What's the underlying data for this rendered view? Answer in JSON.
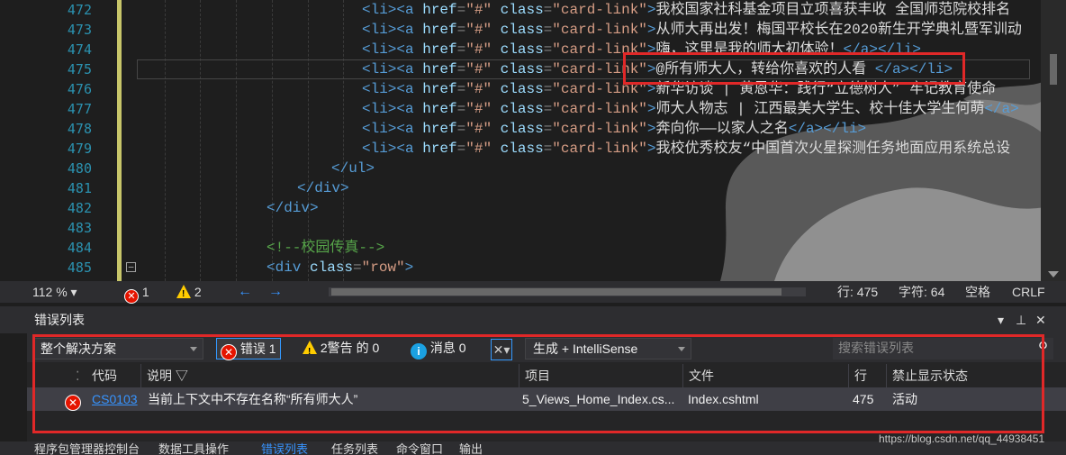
{
  "editor": {
    "lines": [
      {
        "num": "472",
        "text": "我校国家社科基金项目立项喜获丰收 全国师范院校排名"
      },
      {
        "num": "473",
        "text": "从师大再出发！梅国平校长在2020新生开学典礼暨军训动"
      },
      {
        "num": "474",
        "text": "嗨，这里是我的师大初体验！"
      },
      {
        "num": "475",
        "text": "@所有师大人，转给你喜欢的人看"
      },
      {
        "num": "476",
        "text": "新华访谈 | 黄恩华：践行“立德树人” 牢记教育使命"
      },
      {
        "num": "477",
        "text": "师大人物志 | 江西最美大学生、校十佳大学生何萌"
      },
      {
        "num": "478",
        "text": "奔向你——以家人之名"
      },
      {
        "num": "479",
        "text": "我校优秀校友“中国首次火星探测任务地面应用系统总设"
      }
    ],
    "li_open": "<li>",
    "a_open": "<a",
    "href_attr": "href",
    "href_val": "\"#\"",
    "class_attr": "class",
    "class_val": "\"card-link\"",
    "gt": ">",
    "a_close": "</a>",
    "li_close": "</li>",
    "l480": {
      "num": "480",
      "code": "</ul>"
    },
    "l481": {
      "num": "481",
      "code": "</div>"
    },
    "l482": {
      "num": "482",
      "code": "</div>"
    },
    "l483": {
      "num": "483",
      "code": ""
    },
    "l484": {
      "num": "484",
      "code": "<!--校园传真-->"
    },
    "l485": {
      "num": "485",
      "tag": "<div",
      "attr": "class",
      "val": "\"row\"",
      "gt": ">"
    },
    "fold_symbol": "−"
  },
  "status": {
    "zoom": "112 %",
    "errors": "1",
    "warnings": "2",
    "back": "←",
    "forward": "→",
    "line": "行: 475",
    "char": "字符: 64",
    "space": "空格",
    "eol": "CRLF"
  },
  "panel": {
    "title": "错误列表",
    "scope": "整个解决方案",
    "errors_btn": "错误 1",
    "warnings_btn": "2警告 的 0",
    "messages_btn": "消息 0",
    "build_filter": "生成 + IntelliSense",
    "search_placeholder": "搜索错误列表",
    "columns": {
      "code": "代码",
      "desc": "说明",
      "project": "项目",
      "file": "文件",
      "line": "行",
      "suppress": "禁止显示状态"
    },
    "rows": [
      {
        "code": "CS0103",
        "desc": "当前上下文中不存在名称“所有师大人”",
        "project": "5_Views_Home_Index.cs...",
        "file": "Index.cshtml",
        "line": "475",
        "suppress": "活动"
      }
    ]
  },
  "bottom_tabs": [
    "程序包管理器控制台",
    "数据工具操作",
    "错误列表",
    "任务列表",
    "命令窗口",
    "输出"
  ],
  "watermark": "https://blog.csdn.net/qq_44938451",
  "colors": {
    "error_red": "#e51400",
    "highlight_box": "#e02828",
    "link_blue": "#3794ff"
  }
}
